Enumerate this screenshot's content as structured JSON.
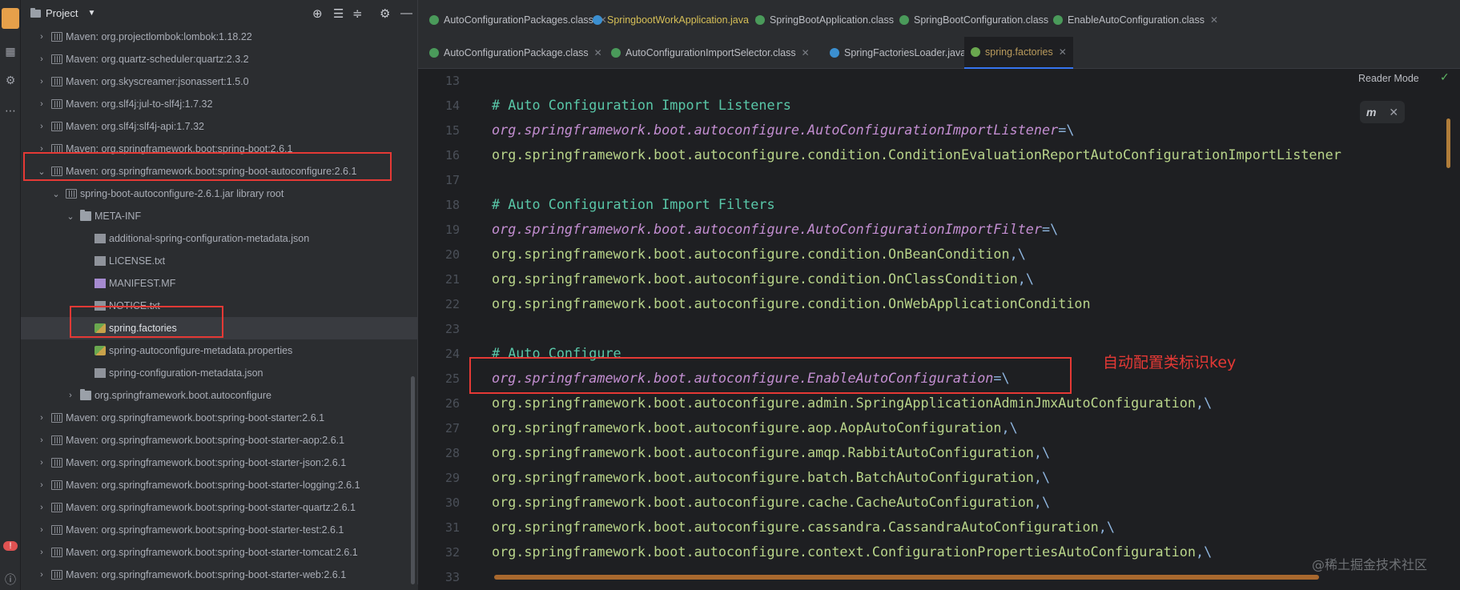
{
  "project_panel": {
    "title": "Project",
    "tree": [
      {
        "label": "Maven: org.projectlombok:lombok:1.18.22",
        "indent": 0,
        "chev": "›",
        "icon": "lib"
      },
      {
        "label": "Maven: org.quartz-scheduler:quartz:2.3.2",
        "indent": 0,
        "chev": "›",
        "icon": "lib"
      },
      {
        "label": "Maven: org.skyscreamer:jsonassert:1.5.0",
        "indent": 0,
        "chev": "›",
        "icon": "lib"
      },
      {
        "label": "Maven: org.slf4j:jul-to-slf4j:1.7.32",
        "indent": 0,
        "chev": "›",
        "icon": "lib"
      },
      {
        "label": "Maven: org.slf4j:slf4j-api:1.7.32",
        "indent": 0,
        "chev": "›",
        "icon": "lib"
      },
      {
        "label": "Maven: org.springframework.boot:spring-boot:2.6.1",
        "indent": 0,
        "chev": "›",
        "icon": "lib"
      },
      {
        "label": "Maven: org.springframework.boot:spring-boot-autoconfigure:2.6.1",
        "indent": 0,
        "chev": "⌄",
        "icon": "lib"
      },
      {
        "label": "spring-boot-autoconfigure-2.6.1.jar  library root",
        "indent": 1,
        "chev": "⌄",
        "icon": "lib"
      },
      {
        "label": "META-INF",
        "indent": 2,
        "chev": "⌄",
        "icon": "folder"
      },
      {
        "label": "additional-spring-configuration-metadata.json",
        "indent": 3,
        "chev": "",
        "icon": "file"
      },
      {
        "label": "LICENSE.txt",
        "indent": 3,
        "chev": "",
        "icon": "file"
      },
      {
        "label": "MANIFEST.MF",
        "indent": 3,
        "chev": "",
        "icon": "mf"
      },
      {
        "label": "NOTICE.txt",
        "indent": 3,
        "chev": "",
        "icon": "file"
      },
      {
        "label": "spring.factories",
        "indent": 3,
        "chev": "",
        "icon": "spring",
        "selected": true
      },
      {
        "label": "spring-autoconfigure-metadata.properties",
        "indent": 3,
        "chev": "",
        "icon": "spring"
      },
      {
        "label": "spring-configuration-metadata.json",
        "indent": 3,
        "chev": "",
        "icon": "file"
      },
      {
        "label": "org.springframework.boot.autoconfigure",
        "indent": 2,
        "chev": "›",
        "icon": "folder"
      },
      {
        "label": "Maven: org.springframework.boot:spring-boot-starter:2.6.1",
        "indent": 0,
        "chev": "›",
        "icon": "lib"
      },
      {
        "label": "Maven: org.springframework.boot:spring-boot-starter-aop:2.6.1",
        "indent": 0,
        "chev": "›",
        "icon": "lib"
      },
      {
        "label": "Maven: org.springframework.boot:spring-boot-starter-json:2.6.1",
        "indent": 0,
        "chev": "›",
        "icon": "lib"
      },
      {
        "label": "Maven: org.springframework.boot:spring-boot-starter-logging:2.6.1",
        "indent": 0,
        "chev": "›",
        "icon": "lib"
      },
      {
        "label": "Maven: org.springframework.boot:spring-boot-starter-quartz:2.6.1",
        "indent": 0,
        "chev": "›",
        "icon": "lib"
      },
      {
        "label": "Maven: org.springframework.boot:spring-boot-starter-test:2.6.1",
        "indent": 0,
        "chev": "›",
        "icon": "lib"
      },
      {
        "label": "Maven: org.springframework.boot:spring-boot-starter-tomcat:2.6.1",
        "indent": 0,
        "chev": "›",
        "icon": "lib"
      },
      {
        "label": "Maven: org.springframework.boot:spring-boot-starter-web:2.6.1",
        "indent": 0,
        "chev": "›",
        "icon": "lib"
      }
    ]
  },
  "tabs_row1": [
    {
      "label": "AutoConfigurationPackages.class",
      "icon_color": "#4a9a5a"
    },
    {
      "label": "SpringbootWorkApplication.java",
      "icon_color": "#3b8fd0",
      "highlight": true
    },
    {
      "label": "SpringBootApplication.class",
      "icon_color": "#4a9a5a"
    },
    {
      "label": "SpringBootConfiguration.class",
      "icon_color": "#4a9a5a"
    },
    {
      "label": "EnableAutoConfiguration.class",
      "icon_color": "#4a9a5a"
    }
  ],
  "tabs_row2": [
    {
      "label": "AutoConfigurationPackage.class",
      "icon_color": "#4a9a5a"
    },
    {
      "label": "AutoConfigurationImportSelector.class",
      "icon_color": "#4a9a5a"
    },
    {
      "label": "SpringFactoriesLoader.java",
      "icon_color": "#3b8fd0"
    },
    {
      "label": "spring.factories",
      "icon_color": "#6aa84f",
      "active": true
    }
  ],
  "editor": {
    "reader_mode": "Reader Mode",
    "popup_icon": "m",
    "line_numbers": [
      "13",
      "14",
      "15",
      "16",
      "17",
      "18",
      "19",
      "20",
      "21",
      "22",
      "23",
      "24",
      "25",
      "26",
      "27",
      "28",
      "29",
      "30",
      "31",
      "32",
      "33"
    ],
    "lines": [
      {
        "type": "blank",
        "text": ""
      },
      {
        "type": "comment",
        "text": "# Auto Configuration Import Listeners"
      },
      {
        "type": "key",
        "text": "org.springframework.boot.autoconfigure.AutoConfigurationImportListener",
        "op": "=\\"
      },
      {
        "type": "val",
        "text": "org.springframework.boot.autoconfigure.condition.ConditionEvaluationReportAutoConfigurationImportListener",
        "op": ""
      },
      {
        "type": "blank",
        "text": ""
      },
      {
        "type": "comment",
        "text": "# Auto Configuration Import Filters"
      },
      {
        "type": "key",
        "text": "org.springframework.boot.autoconfigure.AutoConfigurationImportFilter",
        "op": "=\\"
      },
      {
        "type": "val",
        "text": "org.springframework.boot.autoconfigure.condition.OnBeanCondition",
        "op": ",\\"
      },
      {
        "type": "val",
        "text": "org.springframework.boot.autoconfigure.condition.OnClassCondition",
        "op": ",\\"
      },
      {
        "type": "val",
        "text": "org.springframework.boot.autoconfigure.condition.OnWebApplicationCondition",
        "op": ""
      },
      {
        "type": "blank",
        "text": ""
      },
      {
        "type": "comment",
        "text": "# Auto Configure"
      },
      {
        "type": "key",
        "text": "org.springframework.boot.autoconfigure.EnableAutoConfiguration",
        "op": "=\\"
      },
      {
        "type": "val",
        "text": "org.springframework.boot.autoconfigure.admin.SpringApplicationAdminJmxAutoConfiguration",
        "op": ",\\"
      },
      {
        "type": "val",
        "text": "org.springframework.boot.autoconfigure.aop.AopAutoConfiguration",
        "op": ",\\"
      },
      {
        "type": "val",
        "text": "org.springframework.boot.autoconfigure.amqp.RabbitAutoConfiguration",
        "op": ",\\"
      },
      {
        "type": "val",
        "text": "org.springframework.boot.autoconfigure.batch.BatchAutoConfiguration",
        "op": ",\\"
      },
      {
        "type": "val",
        "text": "org.springframework.boot.autoconfigure.cache.CacheAutoConfiguration",
        "op": ",\\"
      },
      {
        "type": "val",
        "text": "org.springframework.boot.autoconfigure.cassandra.CassandraAutoConfiguration",
        "op": ",\\"
      },
      {
        "type": "val",
        "text": "org.springframework.boot.autoconfigure.context.ConfigurationPropertiesAutoConfiguration",
        "op": ",\\"
      },
      {
        "type": "blank",
        "text": ""
      }
    ]
  },
  "annotation": {
    "text": "自动配置类标识key",
    "color": "#e53935"
  },
  "watermark": "@稀土掘金技术社区",
  "colors": {
    "comment": "#59c7a8",
    "key": "#c38ed1",
    "value": "#b8d48a",
    "operator": "#8fb6e0"
  }
}
